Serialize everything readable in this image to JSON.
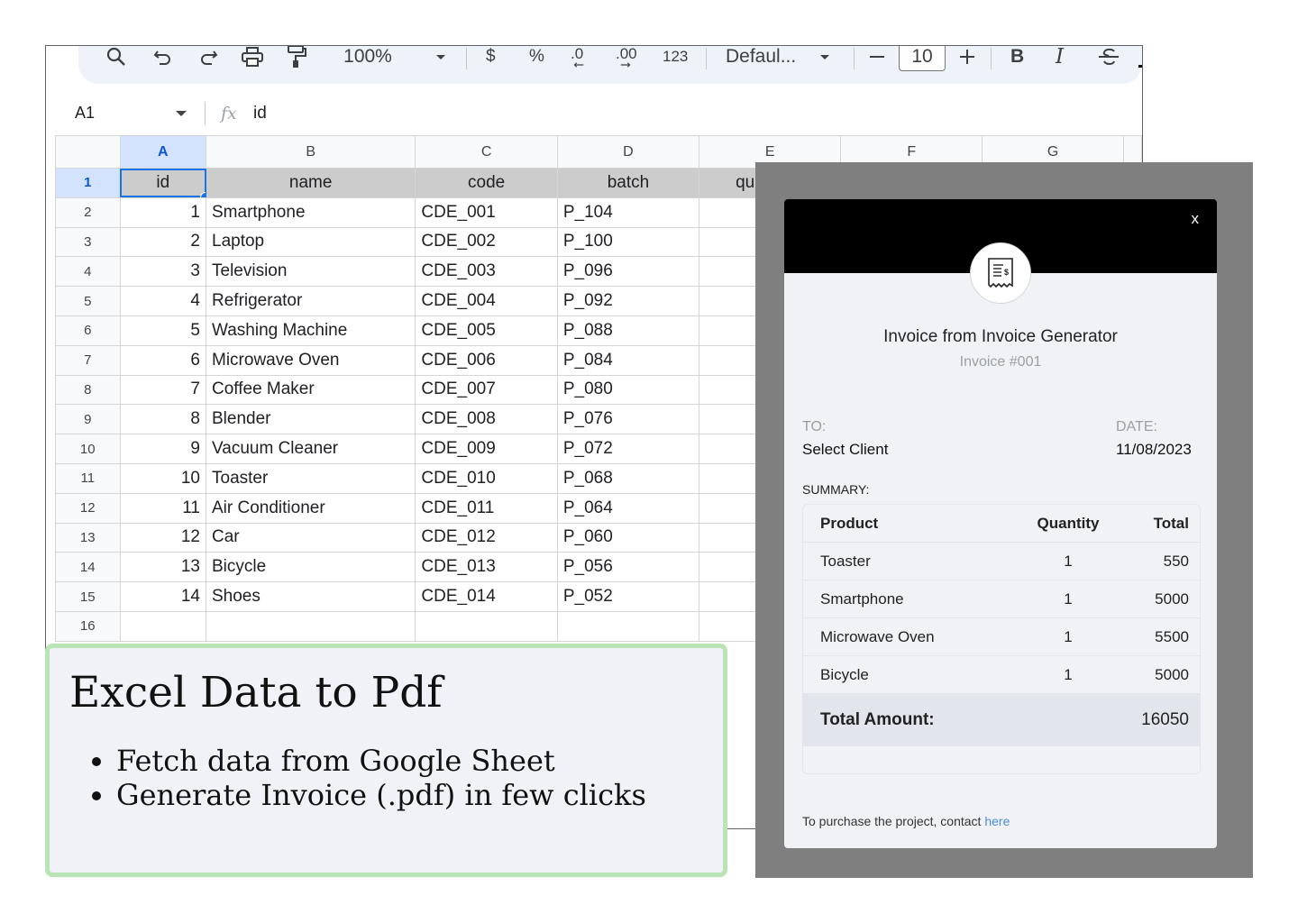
{
  "toolbar": {
    "zoom": "100%",
    "currency": "$",
    "percent": "%",
    "decrease_decimal": ".0",
    "increase_decimal": ".00",
    "number_format": "123",
    "font_name": "Defaul...",
    "font_size": "10",
    "bold": "B",
    "italic": "I",
    "text_color": "A"
  },
  "formula_bar": {
    "cell_ref": "A1",
    "fx": "fx",
    "value": "id"
  },
  "columns": [
    "A",
    "B",
    "C",
    "D",
    "E",
    "F",
    "G"
  ],
  "rows": [
    {
      "n": "1",
      "id": "id",
      "name": "name",
      "code": "code",
      "batch": "batch",
      "e": "qu"
    },
    {
      "n": "2",
      "id": "1",
      "name": "Smartphone",
      "code": "CDE_001",
      "batch": "P_104"
    },
    {
      "n": "3",
      "id": "2",
      "name": "Laptop",
      "code": "CDE_002",
      "batch": "P_100"
    },
    {
      "n": "4",
      "id": "3",
      "name": "Television",
      "code": "CDE_003",
      "batch": "P_096"
    },
    {
      "n": "5",
      "id": "4",
      "name": "Refrigerator",
      "code": "CDE_004",
      "batch": "P_092"
    },
    {
      "n": "6",
      "id": "5",
      "name": "Washing Machine",
      "code": "CDE_005",
      "batch": "P_088"
    },
    {
      "n": "7",
      "id": "6",
      "name": "Microwave Oven",
      "code": "CDE_006",
      "batch": "P_084"
    },
    {
      "n": "8",
      "id": "7",
      "name": "Coffee Maker",
      "code": "CDE_007",
      "batch": "P_080"
    },
    {
      "n": "9",
      "id": "8",
      "name": "Blender",
      "code": "CDE_008",
      "batch": "P_076"
    },
    {
      "n": "10",
      "id": "9",
      "name": "Vacuum Cleaner",
      "code": "CDE_009",
      "batch": "P_072"
    },
    {
      "n": "11",
      "id": "10",
      "name": "Toaster",
      "code": "CDE_010",
      "batch": "P_068"
    },
    {
      "n": "12",
      "id": "11",
      "name": "Air Conditioner",
      "code": "CDE_011",
      "batch": "P_064"
    },
    {
      "n": "13",
      "id": "12",
      "name": "Car",
      "code": "CDE_012",
      "batch": "P_060"
    },
    {
      "n": "14",
      "id": "13",
      "name": "Bicycle",
      "code": "CDE_013",
      "batch": "P_056"
    },
    {
      "n": "15",
      "id": "14",
      "name": "Shoes",
      "code": "CDE_014",
      "batch": "P_052"
    },
    {
      "n": "16",
      "id": "",
      "name": "",
      "code": "",
      "batch": ""
    }
  ],
  "invoice": {
    "close": "x",
    "title": "Invoice from Invoice Generator",
    "number": "Invoice #001",
    "to_label": "TO:",
    "to_value": "Select Client",
    "date_label": "DATE:",
    "date_value": "11/08/2023",
    "summary_label": "SUMMARY:",
    "headers": {
      "product": "Product",
      "quantity": "Quantity",
      "total": "Total"
    },
    "items": [
      {
        "product": "Toaster",
        "quantity": "1",
        "total": "550"
      },
      {
        "product": "Smartphone",
        "quantity": "1",
        "total": "5000"
      },
      {
        "product": "Microwave Oven",
        "quantity": "1",
        "total": "5500"
      },
      {
        "product": "Bicycle",
        "quantity": "1",
        "total": "5000"
      }
    ],
    "total_label": "Total Amount:",
    "total_value": "16050",
    "contact_text": "To purchase the project, contact",
    "contact_link": "here"
  },
  "card": {
    "title": "Excel Data to Pdf",
    "bullets": [
      "Fetch data from Google Sheet",
      "Generate Invoice (.pdf) in few clicks"
    ]
  },
  "colors": {
    "overlay": "#7f7f7f",
    "modal_header": "#000000",
    "card_border": "#b8e5b3",
    "selection": "#1a73e8"
  }
}
